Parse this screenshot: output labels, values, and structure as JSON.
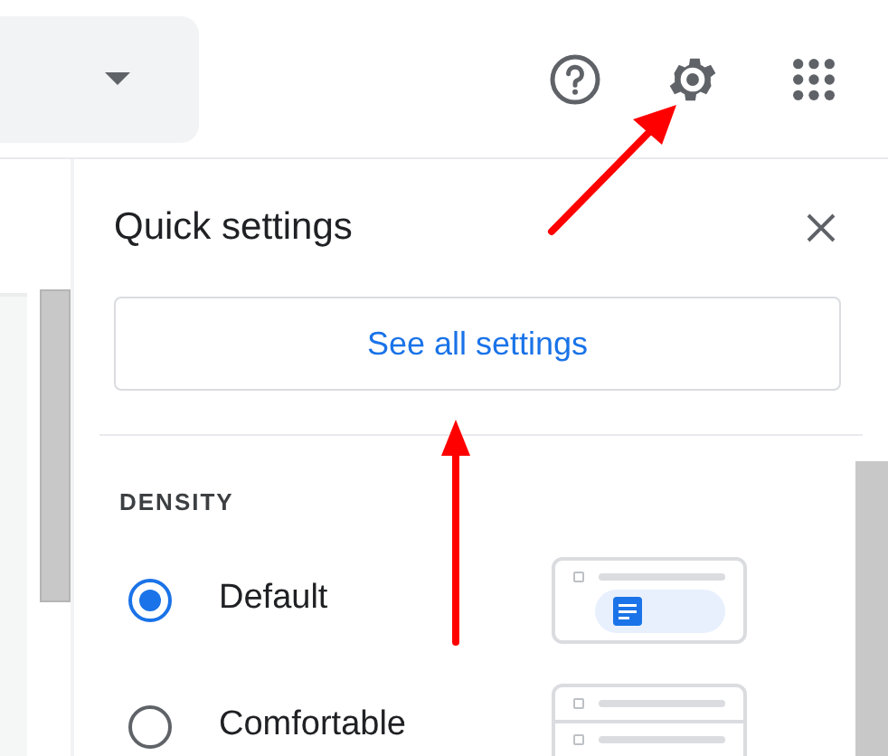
{
  "quick_settings": {
    "title": "Quick settings",
    "see_all_button": "See all settings",
    "density": {
      "heading": "DENSITY",
      "options": [
        {
          "label": "Default",
          "selected": true
        },
        {
          "label": "Comfortable",
          "selected": false
        }
      ]
    }
  }
}
